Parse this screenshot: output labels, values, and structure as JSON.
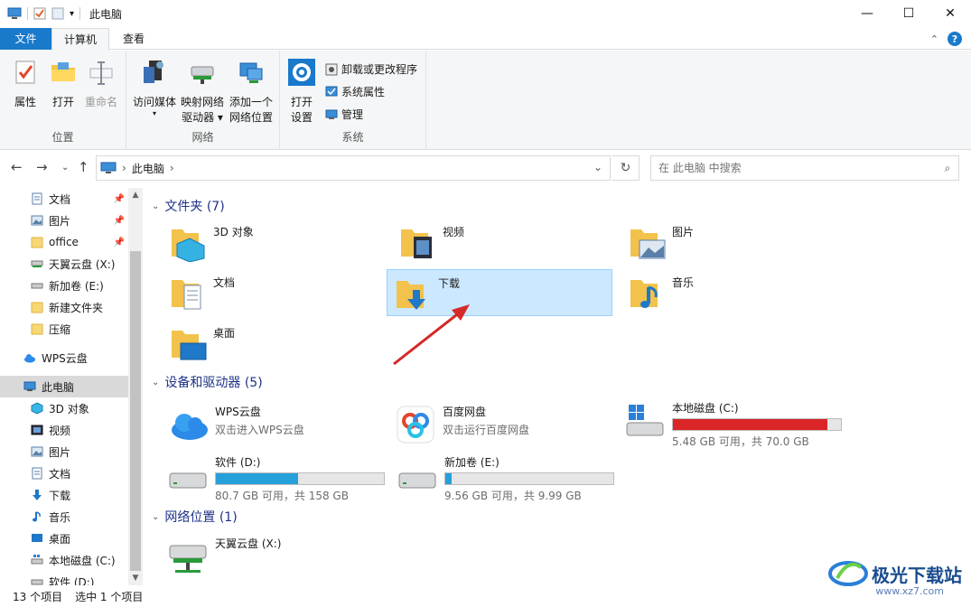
{
  "window": {
    "title": "此电脑"
  },
  "controls": {
    "minimize": "—",
    "maximize": "☐",
    "close": "✕"
  },
  "tabs": {
    "file": "文件",
    "computer": "计算机",
    "view": "查看"
  },
  "ribbon": {
    "location": {
      "label": "位置",
      "properties": "属性",
      "open": "打开",
      "rename": "重命名"
    },
    "network": {
      "label": "网络",
      "media_1": "访问媒体",
      "map_1": "映射网络",
      "map_2": "驱动器 ▾",
      "add_1": "添加一个",
      "add_2": "网络位置"
    },
    "system": {
      "label": "系统",
      "settings_1": "打开",
      "settings_2": "设置",
      "uninstall": "卸载或更改程序",
      "sysprops": "系统属性",
      "manage": "管理"
    }
  },
  "address": {
    "path": "此电脑",
    "search_placeholder": "在 此电脑 中搜索"
  },
  "nav": {
    "quick": [
      {
        "label": "文档",
        "pin": "📌"
      },
      {
        "label": "图片",
        "pin": "📌"
      },
      {
        "label": "office",
        "pin": "📌"
      },
      {
        "label": "天翼云盘 (X:)"
      },
      {
        "label": "新加卷 (E:)"
      },
      {
        "label": "新建文件夹"
      },
      {
        "label": "压缩"
      }
    ],
    "wps": "WPS云盘",
    "this_pc": "此电脑",
    "pc_items": [
      "3D 对象",
      "视频",
      "图片",
      "文档",
      "下载",
      "音乐",
      "桌面",
      "本地磁盘 (C:)",
      "软件 (D:)"
    ]
  },
  "sections": {
    "folders": "文件夹 (7)",
    "devices": "设备和驱动器 (5)",
    "network": "网络位置 (1)"
  },
  "folders": [
    "3D 对象",
    "视频",
    "图片",
    "文档",
    "下载",
    "音乐",
    "桌面"
  ],
  "devices": {
    "wps": {
      "name": "WPS云盘",
      "sub": "双击进入WPS云盘"
    },
    "baidu": {
      "name": "百度网盘",
      "sub": "双击运行百度网盘"
    },
    "c": {
      "name": "本地磁盘 (C:)",
      "sub": "5.48 GB 可用，共 70.0 GB",
      "used_fraction": 0.92,
      "color": "#da2626"
    },
    "d": {
      "name": "软件 (D:)",
      "sub": "80.7 GB 可用，共 158 GB",
      "used_fraction": 0.49,
      "color": "#26a0da"
    },
    "e": {
      "name": "新加卷 (E:)",
      "sub": "9.56 GB 可用，共 9.99 GB",
      "used_fraction": 0.04,
      "color": "#26a0da"
    }
  },
  "network_items": [
    "天翼云盘 (X:)"
  ],
  "status": {
    "count": "13 个项目",
    "selected": "选中 1 个项目"
  },
  "watermark": {
    "main": "极光下载站",
    "url": "www.xz7.com"
  }
}
